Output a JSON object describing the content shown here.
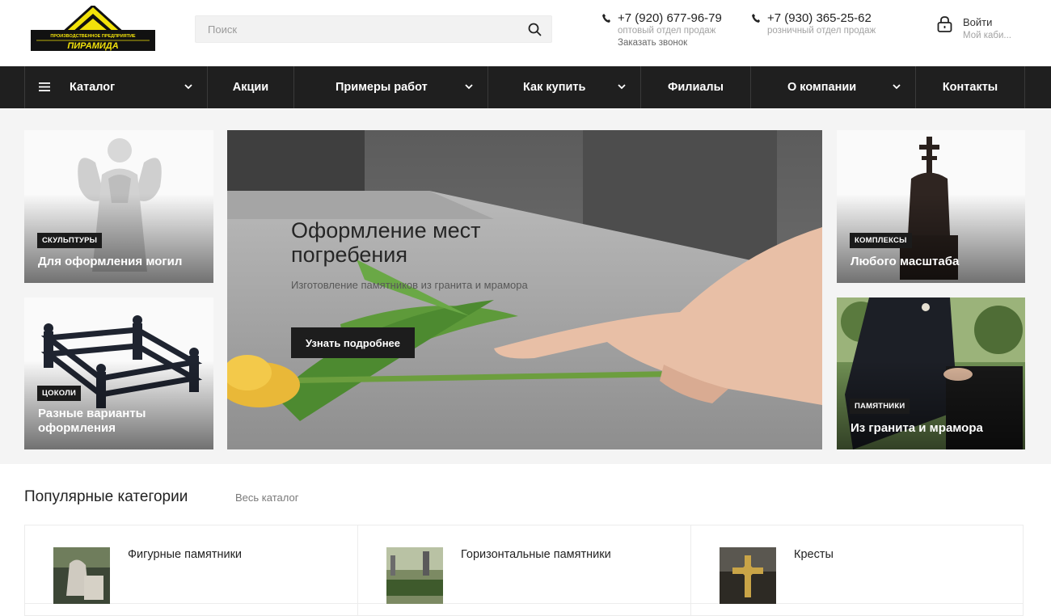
{
  "header": {
    "logo": {
      "top_text": "ПРОИЗВОДСТВЕННОЕ ПРЕДПРИЯТИЕ",
      "name": "ПИРАМИДА"
    },
    "search": {
      "placeholder": "Поиск"
    },
    "phones": [
      {
        "number": "+7 (920) 677-96-79",
        "label": "оптовый отдел продаж",
        "action": "Заказать звонок"
      },
      {
        "number": "+7 (930) 365-25-62",
        "label": "розничный отдел продаж"
      }
    ],
    "login": {
      "label": "Войти",
      "sub": "Мой каби..."
    }
  },
  "nav": {
    "items": [
      {
        "label": "Каталог"
      },
      {
        "label": "Акции"
      },
      {
        "label": "Примеры работ"
      },
      {
        "label": "Как купить"
      },
      {
        "label": "Филиалы"
      },
      {
        "label": "О компании"
      },
      {
        "label": "Контакты"
      }
    ]
  },
  "promo": {
    "tiles": [
      {
        "badge": "СКУЛЬПТУРЫ",
        "caption": "Для оформления могил"
      },
      {
        "badge": "ЦОКОЛИ",
        "caption": "Разные варианты оформления"
      },
      {
        "badge": "КОМПЛЕКСЫ",
        "caption": "Любого масштаба"
      },
      {
        "badge": "ПАМЯТНИКИ",
        "caption": "Из гранита и мрамора"
      }
    ],
    "hero": {
      "title": "Оформление мест погребения",
      "subtitle": "Изготовление памятников из гранита и мрамора",
      "button": "Узнать подробнее"
    }
  },
  "popular": {
    "title": "Популярные категории",
    "link": "Весь каталог",
    "categories": [
      {
        "name": "Фигурные памятники"
      },
      {
        "name": "Горизонтальные памятники"
      },
      {
        "name": "Кресты"
      }
    ]
  },
  "colors": {
    "nav_bg": "#1f1f1f",
    "logo_yellow": "#f2e20a",
    "badge_bg": "#1b1b1b"
  }
}
